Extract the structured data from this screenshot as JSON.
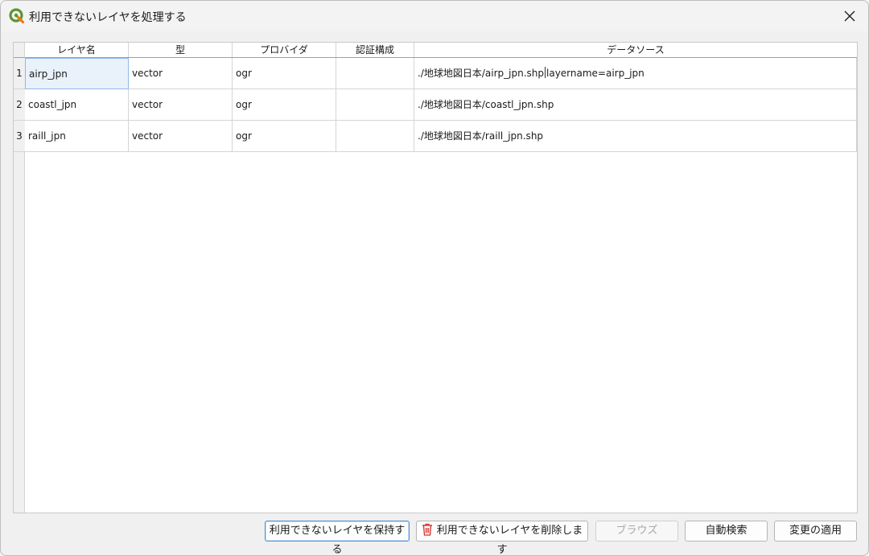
{
  "window": {
    "title": "利用できないレイヤを処理する"
  },
  "table": {
    "columns": [
      "レイヤ名",
      "型",
      "プロバイダ",
      "認証構成",
      "データソース"
    ],
    "rows": [
      {
        "num": "1",
        "layer": "airp_jpn",
        "type": "vector",
        "provider": "ogr",
        "auth": "",
        "source_a": "./地球地図日本/airp_jpn.shp",
        "source_b": "layername=airp_jpn"
      },
      {
        "num": "2",
        "layer": "coastl_jpn",
        "type": "vector",
        "provider": "ogr",
        "auth": "",
        "source_a": "./地球地図日本/coastl_jpn.shp",
        "source_b": ""
      },
      {
        "num": "3",
        "layer": "raill_jpn",
        "type": "vector",
        "provider": "ogr",
        "auth": "",
        "source_a": "./地球地図日本/raill_jpn.shp",
        "source_b": ""
      }
    ]
  },
  "buttons": {
    "keep": "利用できないレイヤを保持する",
    "remove": "利用できないレイヤを削除します",
    "browse": "ブラウズ",
    "auto_search": "自動検索",
    "apply": "変更の適用"
  },
  "colors": {
    "qgis_green": "#589632",
    "qgis_yellow": "#ee7913",
    "trash_red": "#d32f2f",
    "selection_border": "#8fb8ea"
  }
}
